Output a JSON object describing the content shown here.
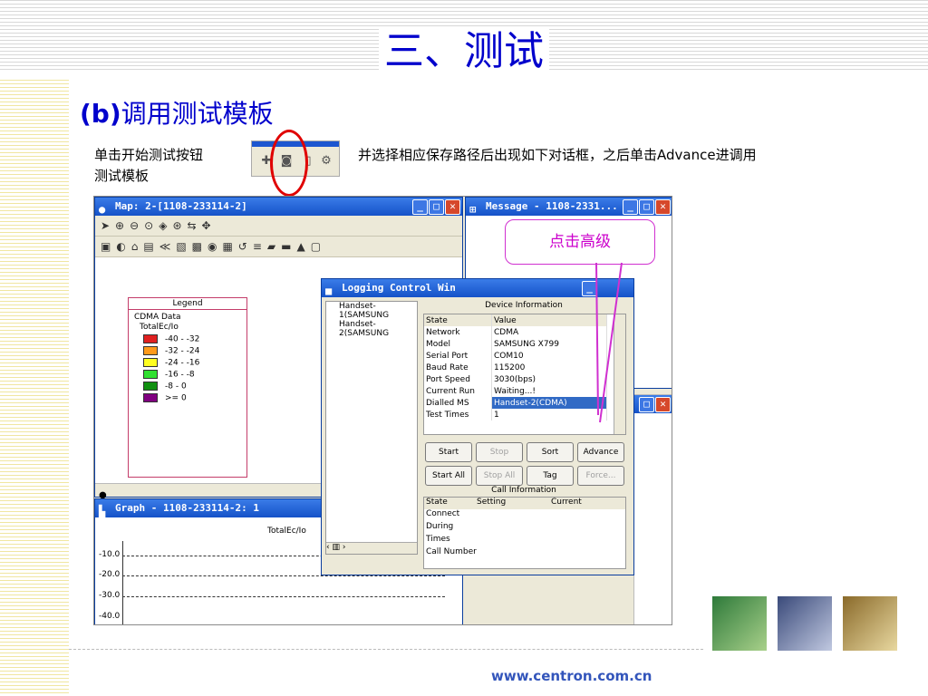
{
  "slide": {
    "title": "三、测试",
    "subtitle_prefix": "(b)",
    "subtitle_rest": "调用测试模板",
    "desc_part1": "单击开始测试按钮",
    "desc_part2": "并选择相应保存路径后出现如下对话框，之后单击Advance进调用",
    "desc_part3": "测试模板",
    "callout": "点击高级",
    "footer": "www.centron.com.cn"
  },
  "map_window": {
    "title": "Map: 2-[1108-233114-2]"
  },
  "legend": {
    "title": "Legend",
    "group": "CDMA Data",
    "metric": "TotalEc/Io",
    "items": [
      {
        "label": "-40 - -32",
        "color": "#e02020"
      },
      {
        "label": "-32 - -24",
        "color": "#ff9a1a"
      },
      {
        "label": "-24 - -16",
        "color": "#ffff20"
      },
      {
        "label": "-16 - -8",
        "color": "#30e030"
      },
      {
        "label": "-8 - 0",
        "color": "#109010"
      },
      {
        "label": ">= 0",
        "color": "#800080"
      }
    ]
  },
  "graph_window": {
    "title": "Graph - 1108-233114-2: 1",
    "series_label": "TotalEc/Io",
    "y_labels": [
      "-10.0",
      "-20.0",
      "-30.0",
      "-40.0"
    ]
  },
  "message_window": {
    "title": "Message - 1108-2331..."
  },
  "logging": {
    "title": "Logging Control Win",
    "handsets": [
      "Handset-1(SAMSUNG",
      "Handset-2(SAMSUNG"
    ],
    "device_info_header": "Device Information",
    "device_cols": [
      "State",
      "Value"
    ],
    "device_rows": [
      [
        "Network",
        "CDMA"
      ],
      [
        "Model",
        "SAMSUNG X799"
      ],
      [
        "Serial Port",
        "COM10"
      ],
      [
        "Baud Rate",
        "115200"
      ],
      [
        "Port Speed",
        "3030(bps)"
      ],
      [
        "Current Run",
        "Waiting...!"
      ],
      [
        "Dialled MS",
        "Handset-2(CDMA)"
      ],
      [
        "Test Times",
        "1"
      ]
    ],
    "buttons_row1": [
      "Start",
      "Stop",
      "Sort",
      "Advance"
    ],
    "buttons_row2": [
      "Start All",
      "Stop All",
      "Tag",
      "Force..."
    ],
    "call_info_header": "Call Information",
    "call_cols": [
      "State",
      "Setting",
      "Current"
    ],
    "call_rows": [
      "Connect",
      "During",
      "Times",
      "Call Number"
    ]
  }
}
